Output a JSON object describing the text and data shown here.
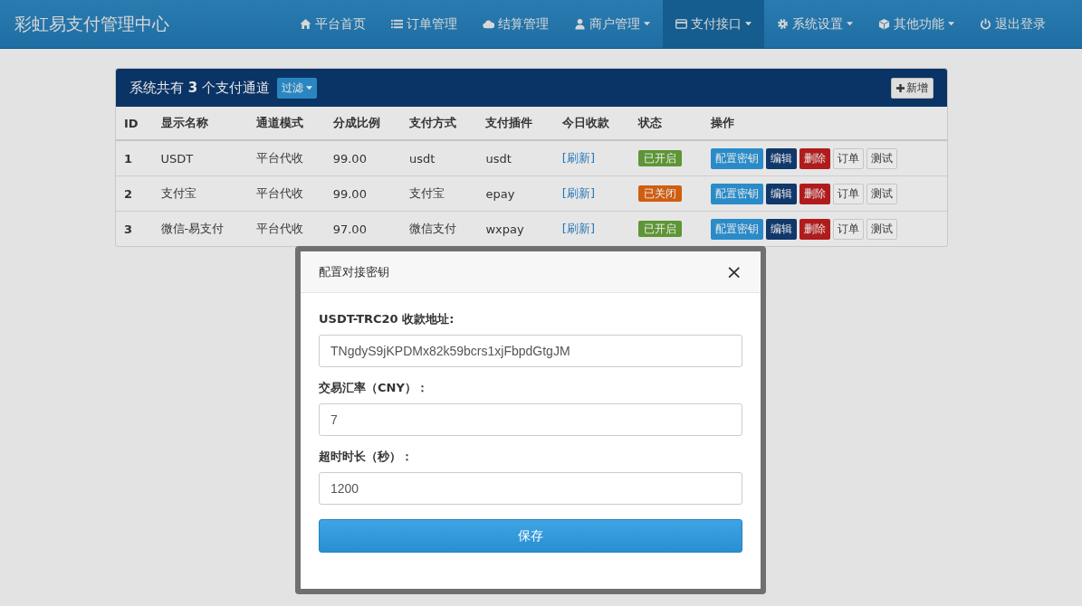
{
  "navbar": {
    "brand": "彩虹易支付管理中心",
    "items": [
      {
        "label": "平台首页",
        "kind": "home",
        "dropdown": false,
        "selected": false
      },
      {
        "label": "订单管理",
        "kind": "list",
        "dropdown": false,
        "selected": false
      },
      {
        "label": "结算管理",
        "kind": "cloud",
        "dropdown": false,
        "selected": false
      },
      {
        "label": "商户管理",
        "kind": "user",
        "dropdown": true,
        "selected": false
      },
      {
        "label": "支付接口",
        "kind": "card",
        "dropdown": true,
        "selected": true
      },
      {
        "label": "系统设置",
        "kind": "gear",
        "dropdown": true,
        "selected": false
      },
      {
        "label": "其他功能",
        "kind": "cube",
        "dropdown": true,
        "selected": false
      },
      {
        "label": "退出登录",
        "kind": "power",
        "dropdown": false,
        "selected": false
      }
    ]
  },
  "panel": {
    "title": "系统共有 **3** 个支付通道",
    "filter_button": "过滤",
    "add_button": "新增",
    "columns": [
      "ID",
      "显示名称",
      "通道模式",
      "分成比例",
      "支付方式",
      "支付插件",
      "今日收款",
      "状态",
      "操作"
    ],
    "rows": [
      {
        "id": "1",
        "name": "USDT",
        "mode": "平台代收",
        "ratio": "99.00",
        "method": "usdt",
        "plugin": "usdt",
        "today": "[刷新]",
        "status": "已开启",
        "enabled": true,
        "actions": [
          {
            "label": "配置密钥",
            "kind": "primary"
          },
          {
            "label": "编辑",
            "kind": "dark"
          },
          {
            "label": "删除",
            "kind": "danger"
          },
          {
            "label": "订单",
            "kind": "plain"
          },
          {
            "label": "测试",
            "kind": "plain"
          }
        ]
      },
      {
        "id": "2",
        "name": "支付宝",
        "mode": "平台代收",
        "ratio": "99.00",
        "method": "支付宝",
        "plugin": "epay",
        "today": "[刷新]",
        "status": "已关闭",
        "enabled": false,
        "actions": [
          {
            "label": "配置密钥",
            "kind": "primary"
          },
          {
            "label": "编辑",
            "kind": "dark"
          },
          {
            "label": "删除",
            "kind": "danger"
          },
          {
            "label": "订单",
            "kind": "plain"
          },
          {
            "label": "测试",
            "kind": "plain"
          }
        ]
      },
      {
        "id": "3",
        "name": "微信-易支付",
        "mode": "平台代收",
        "ratio": "97.00",
        "method": "微信支付",
        "plugin": "wxpay",
        "today": "[刷新]",
        "status": "已开启",
        "enabled": true,
        "actions": [
          {
            "label": "配置密钥",
            "kind": "primary"
          },
          {
            "label": "编辑",
            "kind": "dark"
          },
          {
            "label": "删除",
            "kind": "danger"
          },
          {
            "label": "订单",
            "kind": "plain"
          },
          {
            "label": "测试",
            "kind": "plain"
          }
        ]
      }
    ]
  },
  "modal": {
    "title": "配置对接密钥",
    "close": "×",
    "fields": [
      {
        "label": "USDT-TRC20 收款地址:",
        "value": "TNgdyS9jKPDMx82k59bcrs1xjFbpdGtgJM"
      },
      {
        "label": "交易汇率（CNY）：",
        "value": "7"
      },
      {
        "label": "超时时长（秒）：",
        "value": "1200"
      }
    ],
    "save_button": "保存"
  }
}
